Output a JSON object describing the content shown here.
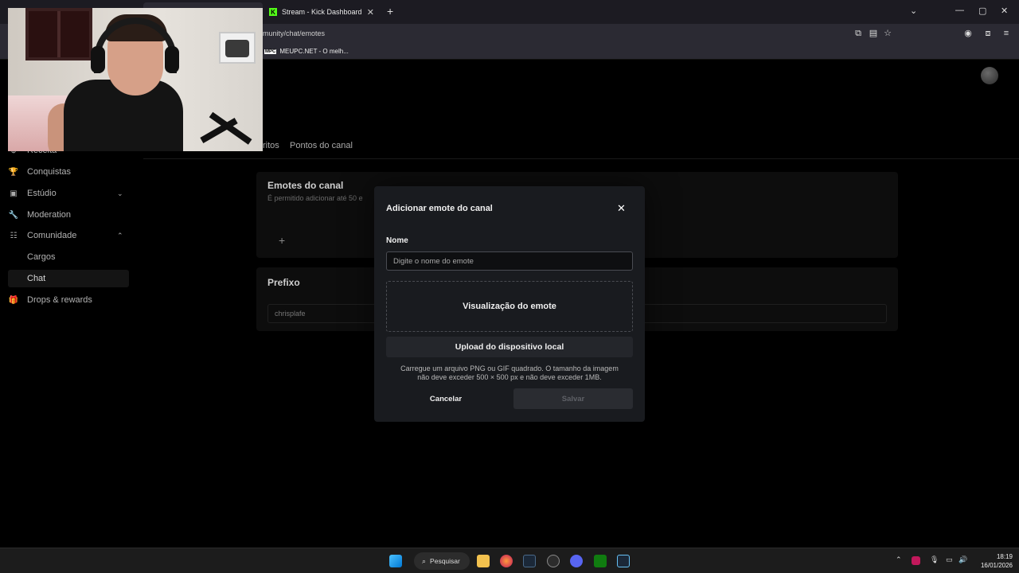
{
  "browser": {
    "tab_active": {
      "title": "Stream - Kick Dashboard",
      "close": "✕"
    },
    "new_tab": "+",
    "url": "munity/chat/emotes",
    "bookmark": {
      "icon_text": "MPC",
      "label": "MEUPC.NET - O melh..."
    },
    "window_controls": {
      "dropdown": "⌄",
      "minimize": "—",
      "maximize": "▢",
      "close": "✕"
    }
  },
  "sidebar": {
    "items": [
      {
        "label": "Receita",
        "icon": "dollar-icon",
        "glyph": "$"
      },
      {
        "label": "Conquistas",
        "icon": "trophy-icon",
        "glyph": "🏆"
      },
      {
        "label": "Estúdio",
        "icon": "studio-icon",
        "glyph": "▣",
        "chevron": "⌄"
      },
      {
        "label": "Moderation",
        "icon": "wrench-icon",
        "glyph": "🔧"
      },
      {
        "label": "Comunidade",
        "icon": "community-icon",
        "glyph": "☷",
        "chevron": "⌃"
      },
      {
        "label": "Cargos"
      },
      {
        "label": "Chat",
        "active": true
      },
      {
        "label": "Drops & rewards",
        "icon": "gift-icon",
        "glyph": "🎁"
      }
    ]
  },
  "subtabs": [
    "ritos",
    "Pontos do canal"
  ],
  "emotes_panel": {
    "title": "Emotes do canal",
    "subtitle": "É permitido adicionar até 50 e",
    "add": "+"
  },
  "prefix_panel": {
    "title": "Prefixo",
    "value": "chrisplafe"
  },
  "modal": {
    "title": "Adicionar emote do canal",
    "close": "✕",
    "name_label": "Nome",
    "name_placeholder": "Digite o nome do emote",
    "preview_label": "Visualização do emote",
    "upload_label": "Upload do dispositivo local",
    "help_line1": "Carregue um arquivo PNG ou GIF quadrado. O tamanho da imagem",
    "help_line2": "não deve exceder 500 × 500 px e não deve exceder 1MB.",
    "cancel_label": "Cancelar",
    "save_label": "Salvar"
  },
  "taskbar": {
    "search_label": "Pesquisar",
    "time": "18:19",
    "date": "16/01/2026"
  },
  "colors": {
    "accent": "#53fc18",
    "modal_bg": "#191b1f",
    "page_bg": "#000000"
  }
}
